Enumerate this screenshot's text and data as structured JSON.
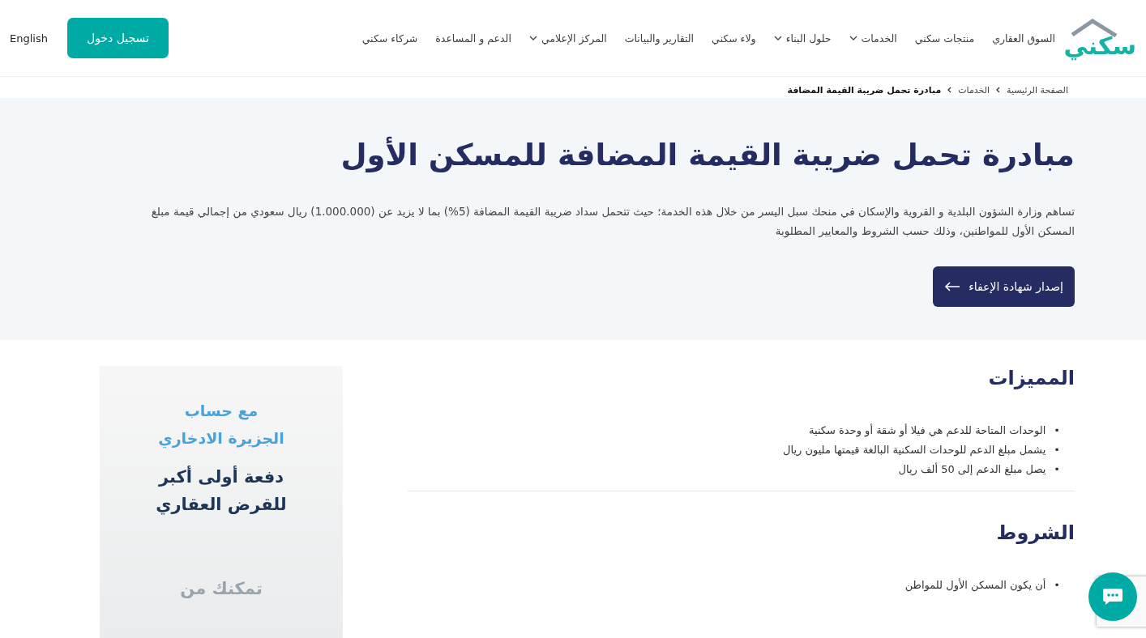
{
  "logo": {
    "text": "سكني"
  },
  "nav": [
    {
      "label": "السوق العقاري",
      "dropdown": false
    },
    {
      "label": "منتجات سكني",
      "dropdown": false
    },
    {
      "label": "الخدمات",
      "dropdown": true
    },
    {
      "label": "حلول البناء",
      "dropdown": true
    },
    {
      "label": "ولاء سكني",
      "dropdown": false
    },
    {
      "label": "التقارير والبيانات",
      "dropdown": false
    },
    {
      "label": "المركز الإعلامي",
      "dropdown": true
    },
    {
      "label": "الدعم و المساعدة",
      "dropdown": false
    },
    {
      "label": "شركاء سكني",
      "dropdown": false
    }
  ],
  "language": "English",
  "login_button": "تسجيل دخول",
  "breadcrumb": [
    {
      "label": "الصفحة الرئيسية",
      "current": false
    },
    {
      "label": "الخدمات",
      "current": false
    },
    {
      "label": "مبادرة تحمل ضريبة القيمة المضافة",
      "current": true
    }
  ],
  "hero": {
    "title": "مبادرة تحمل ضريبة القيمة المضافة للمسكن الأول",
    "description": "تساهم وزارة الشؤون البلدية و القروية والإسكان في منحك سبل اليسر من خلال هذه الخدمة؛ حيث تتحمل سداد ضريبة القيمة المضافة (5%) بما لا يزيد عن (1.000.000) ريال سعودي من إجمالي قيمة مبلغ المسكن الأول للمواطنين، وذلك حسب الشروط والمعايير المطلوبة",
    "button": "إصدار شهادة الإعفاء"
  },
  "list_marker": "•",
  "sections": [
    {
      "title": "المميزات",
      "items": [
        "الوحدات المتاحة للدعم هي فيلا أو شقة أو وحدة سكنية",
        "يشمل مبلغ الدعم للوحدات السكنية البالغة قيمتها مليون ريال",
        "يصل مبلغ الدعم إلى 50 ألف ريال"
      ]
    },
    {
      "title": "الشروط",
      "items": [
        "أن يكون المسكن الأول للمواطن"
      ]
    }
  ],
  "banner": {
    "lines": [
      {
        "text": "مع حساب",
        "kind": "light"
      },
      {
        "text": "الجزيرة الادخاري",
        "kind": "light"
      },
      {
        "text": "دفعة أولى أكبر",
        "kind": "dark"
      },
      {
        "text": "للقرض العقاري",
        "kind": "dark"
      },
      {
        "text": "تمكنك من",
        "kind": "faded"
      }
    ]
  }
}
